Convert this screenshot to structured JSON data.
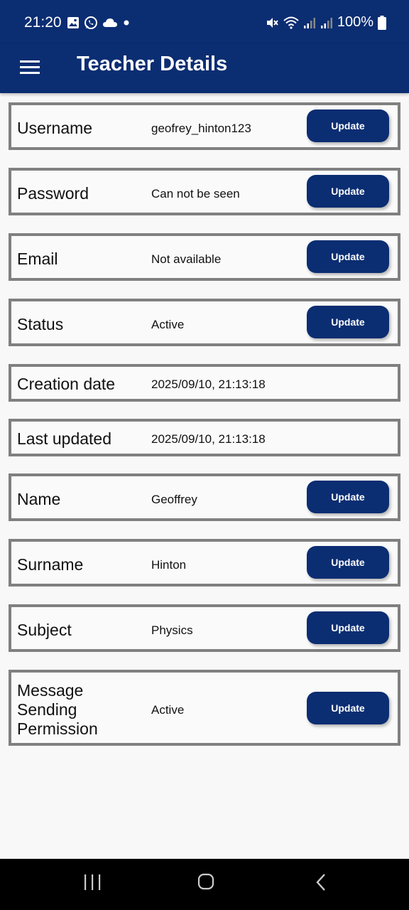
{
  "status_bar": {
    "time": "21:20",
    "battery": "100%",
    "left_icons": [
      "gallery-icon",
      "whatsapp-icon",
      "cloud-icon",
      "dot-icon"
    ],
    "right_icons": [
      "mute-icon",
      "wifi-icon",
      "signal-icon",
      "signal-icon",
      "battery-icon"
    ]
  },
  "app_bar": {
    "title": "Teacher Details",
    "menu_icon": "hamburger-menu-icon"
  },
  "colors": {
    "primary": "#0b2d72",
    "border": "#808080",
    "background": "#f8f8f8"
  },
  "fields": [
    {
      "label": "Username",
      "value": "geofrey_hinton123",
      "button": "Update"
    },
    {
      "label": "Password",
      "value": "Can not be seen",
      "button": "Update"
    },
    {
      "label": "Email",
      "value": "Not available",
      "button": "Update"
    },
    {
      "label": "Status",
      "value": "Active",
      "button": "Update"
    },
    {
      "label": "Creation date",
      "value": "2025/09/10, 21:13:18"
    },
    {
      "label": "Last updated",
      "value": "2025/09/10, 21:13:18"
    },
    {
      "label": "Name",
      "value": "Geoffrey",
      "button": "Update"
    },
    {
      "label": "Surname",
      "value": "Hinton",
      "button": "Update"
    },
    {
      "label": "Subject",
      "value": "Physics",
      "button": "Update"
    },
    {
      "label": "Message Sending Permission",
      "value": "Active",
      "button": "Update"
    }
  ],
  "nav_bar": {
    "icons": [
      "recent-apps-icon",
      "home-icon",
      "back-icon"
    ]
  }
}
